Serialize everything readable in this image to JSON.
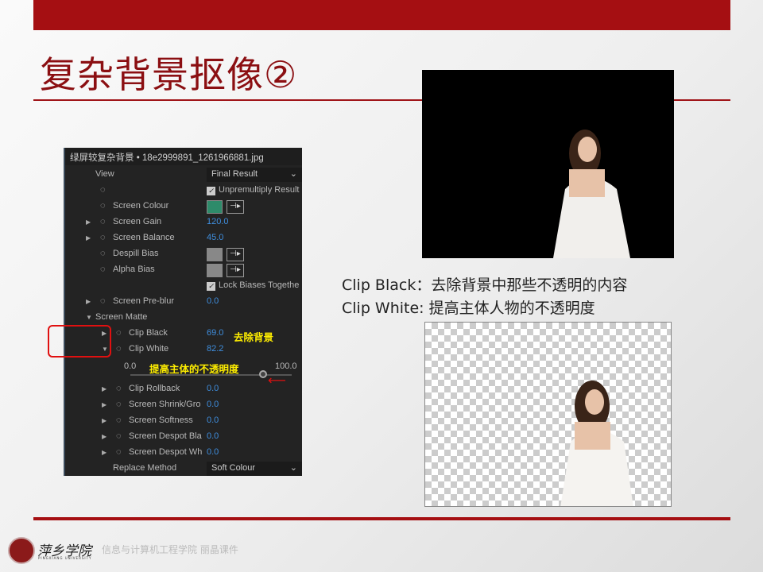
{
  "slide": {
    "title": "复杂背景抠像②",
    "footer": "信息与计算机工程学院  丽晶课件",
    "logo_text": "萍乡学院",
    "logo_sub": "PINGXIANG UNIVERSITY"
  },
  "panel": {
    "header": "绿屏较复杂背景 • 18e2999891_1261966881.jpg",
    "view_label": "View",
    "view_value": "Final Result",
    "unpremultiply": "Unpremultiply Result",
    "screen_colour": "Screen Colour",
    "screen_colour_hex": "#2e8b6a",
    "screen_gain": "Screen Gain",
    "screen_gain_val": "120.0",
    "screen_balance": "Screen Balance",
    "screen_balance_val": "45.0",
    "despill_bias": "Despill Bias",
    "alpha_bias": "Alpha Bias",
    "lock_biases": "Lock Biases Togethe",
    "pre_blur": "Screen Pre-blur",
    "pre_blur_val": "0.0",
    "screen_matte": "Screen Matte",
    "clip_black": "Clip Black",
    "clip_black_val": "69.0",
    "clip_white": "Clip White",
    "clip_white_val": "82.2",
    "slider_min": "0.0",
    "slider_max": "100.0",
    "slider_value": 82.2,
    "clip_rollback": "Clip Rollback",
    "clip_rollback_val": "0.0",
    "shrink": "Screen Shrink/Gro",
    "shrink_val": "0.0",
    "softness": "Screen Softness",
    "softness_val": "0.0",
    "despot_black": "Screen Despot Bla",
    "despot_black_val": "0.0",
    "despot_white": "Screen Despot Wh",
    "despot_white_val": "0.0",
    "replace_method": "Replace Method",
    "replace_value": "Soft Colour",
    "annotation_black": "去除背景",
    "annotation_white": "提高主体的不透明度"
  },
  "captions": {
    "line1": "Clip Black：去除背景中那些不透明的内容",
    "line2": "Clip White:   提高主体人物的不透明度"
  }
}
